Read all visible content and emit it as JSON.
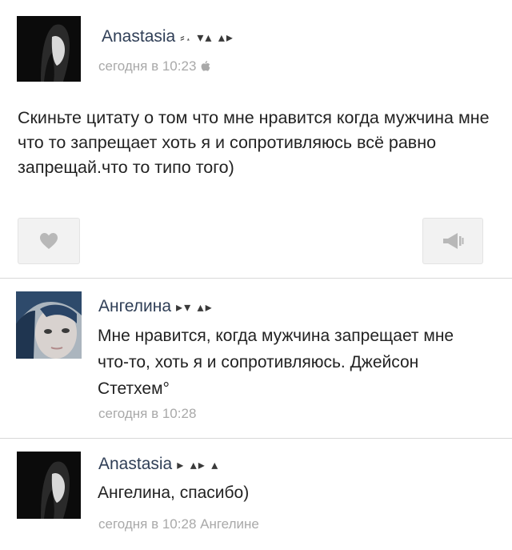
{
  "post": {
    "author": "Anastasia",
    "author_glyphs": "⸗˔ ▾▴ ▴▸",
    "time": "сегодня в 10:23",
    "device_icon": "apple-icon",
    "text": "Скиньте цитату о том что мне нравится когда мужчина мне что то запрещает хоть я и сопротивляюсь всё равно запрещай.что то типо того)",
    "like_icon": "heart-icon",
    "share_icon": "megaphone-icon"
  },
  "comments": [
    {
      "author": "Ангелина",
      "author_glyphs": "▸▾ ▴▸",
      "text": "Мне нравится, когда мужчина запрещает мне что-то, хоть я и сопротивляюсь. Джейсон Стетхем°",
      "time": "сегодня в 10:28"
    },
    {
      "author": "Anastasia",
      "author_glyphs": "▸ ▴▸ ▴",
      "text": "Ангелина, спасибо)",
      "time": "сегодня в 10:28 Ангелине"
    }
  ],
  "colors": {
    "author_name": "#2f3e56",
    "meta_gray": "#a9a9a9",
    "button_bg": "#f2f2f2",
    "icon_gray": "#b8b8b8"
  }
}
